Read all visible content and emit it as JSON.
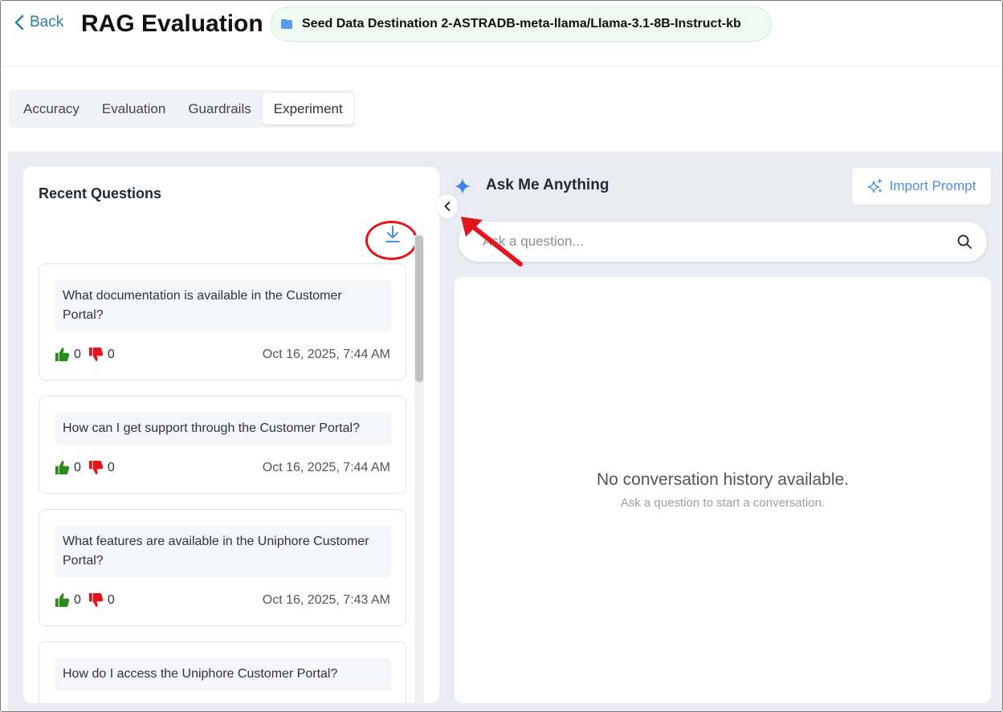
{
  "header": {
    "back_label": "Back",
    "title": "RAG Evaluation",
    "kb_name": "Seed Data Destination 2-ASTRADB-meta-llama/Llama-3.1-8B-Instruct-kb"
  },
  "tabs": [
    {
      "label": "Accuracy",
      "active": false
    },
    {
      "label": "Evaluation",
      "active": false
    },
    {
      "label": "Guardrails",
      "active": false
    },
    {
      "label": "Experiment",
      "active": true
    }
  ],
  "recent": {
    "title": "Recent Questions",
    "items": [
      {
        "question": "What documentation is available in the Customer Portal?",
        "likes": "0",
        "dislikes": "0",
        "date": "Oct 16, 2025, 7:44 AM"
      },
      {
        "question": "How can I get support through the Customer Portal?",
        "likes": "0",
        "dislikes": "0",
        "date": "Oct 16, 2025, 7:44 AM"
      },
      {
        "question": "What features are available in the Uniphore Customer Portal?",
        "likes": "0",
        "dislikes": "0",
        "date": "Oct 16, 2025, 7:43 AM"
      },
      {
        "question": "How do I access the Uniphore Customer Portal?",
        "likes": "",
        "dislikes": "",
        "date": ""
      }
    ]
  },
  "ask": {
    "title": "Ask Me Anything",
    "import_label": "Import Prompt",
    "search_placeholder": "Ask a question...",
    "empty_title": "No conversation history available.",
    "empty_subtitle": "Ask a question to start a conversation."
  },
  "colors": {
    "accent_blue": "#4a8fe7",
    "back_link": "#2a7fa6",
    "like_green": "#2c8a1a",
    "dislike_red": "#e3141b",
    "annotation_red": "#e3141b",
    "badge_bg": "#eefaf2"
  },
  "icons": {
    "back": "chevron-left-icon",
    "kb": "database-icon",
    "download": "download-icon",
    "collapse": "chevron-left-icon",
    "ask": "sparkle-icon",
    "import": "sparkles-icon",
    "search": "search-icon",
    "like": "thumbs-up-icon",
    "dislike": "thumbs-down-icon"
  }
}
